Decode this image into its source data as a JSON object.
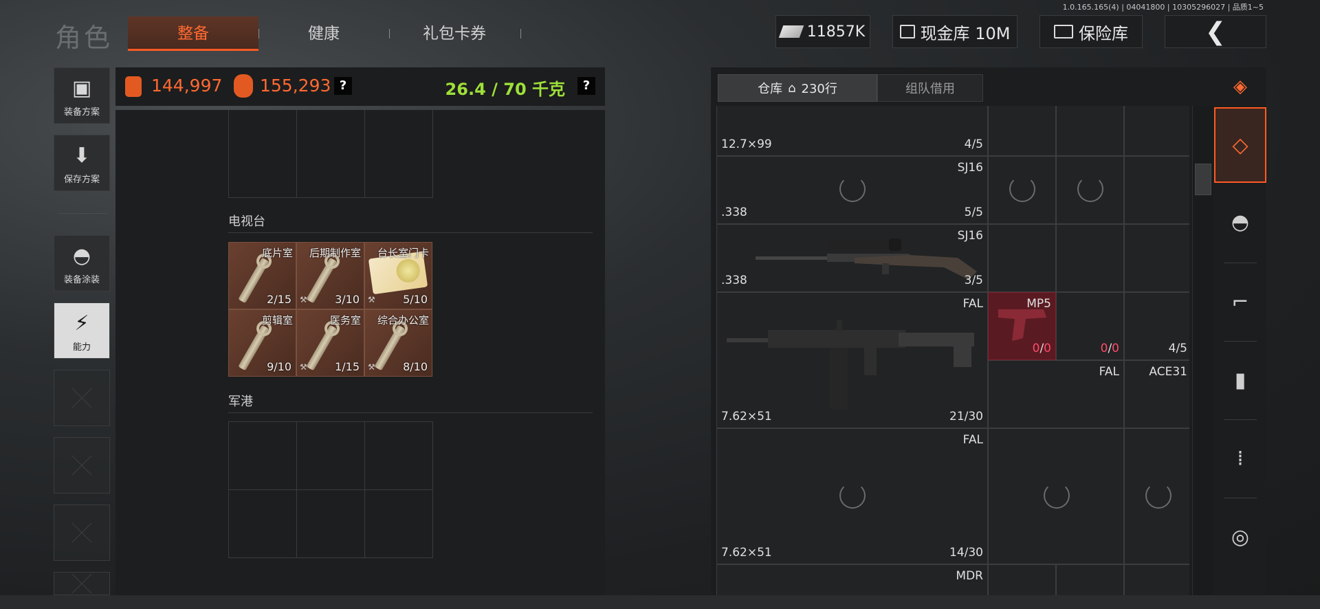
{
  "version": "1.0.165.165(4) | 04041800 | 10305296027 | 品质1~5",
  "header": {
    "role_title": "角色",
    "tabs": [
      {
        "label": "整备",
        "active": true
      },
      {
        "label": "健康",
        "active": false
      },
      {
        "label": "礼包卡券",
        "active": false
      }
    ],
    "money": "11857K",
    "cash_button": "现金库 10M",
    "safe_button": "保险库"
  },
  "left_nav": [
    {
      "label": "装备方案",
      "icon": "vest-icon"
    },
    {
      "label": "保存方案",
      "icon": "download-icon"
    },
    {
      "label": "装备涂装",
      "icon": "helmet-icon"
    },
    {
      "label": "能力",
      "icon": "lightning-icon",
      "active": true
    }
  ],
  "stats": {
    "value_1": "144,997",
    "value_2": "155,293",
    "help": "?",
    "weight": "26.4 / 70 千克"
  },
  "sections": {
    "tv_station": {
      "title": "电视台",
      "keys": [
        {
          "name": "底片室",
          "count": "2/15"
        },
        {
          "name": "后期制作室",
          "count": "3/10"
        },
        {
          "name": "台长室门卡",
          "count": "5/10"
        },
        {
          "name": "剪辑室",
          "count": "9/10"
        },
        {
          "name": "医务室",
          "count": "1/15"
        },
        {
          "name": "综合办公室",
          "count": "8/10"
        }
      ]
    },
    "naval_port": {
      "title": "军港"
    }
  },
  "warehouse": {
    "tab_label": "仓库",
    "capacity": "230行",
    "team_tab": "组队借用",
    "items": [
      {
        "caliber": "12.7×99",
        "count": "4/5"
      },
      {
        "name": "SJ16",
        "caliber": ".338",
        "count": "5/5"
      },
      {
        "name": "SJ16",
        "caliber": ".338",
        "count": "3/5"
      },
      {
        "name": "FAL",
        "caliber": "7.62×51",
        "count": "21/30"
      },
      {
        "name": "MP5",
        "count_a": "0",
        "count_b": "0"
      },
      {
        "count_a": "0",
        "count_b": "0"
      },
      {
        "count": "4/5"
      },
      {
        "name": "FAL"
      },
      {
        "name": "ACE31"
      },
      {
        "name": "FAL",
        "caliber": "7.62×51",
        "count": "14/30"
      },
      {
        "name": "MDR"
      }
    ]
  },
  "right_column_icons": [
    "layers-refresh-icon",
    "layers-icon",
    "helmet-icon",
    "rifle-icon",
    "magazine-icon",
    "ammo-icon",
    "scope-icon"
  ]
}
